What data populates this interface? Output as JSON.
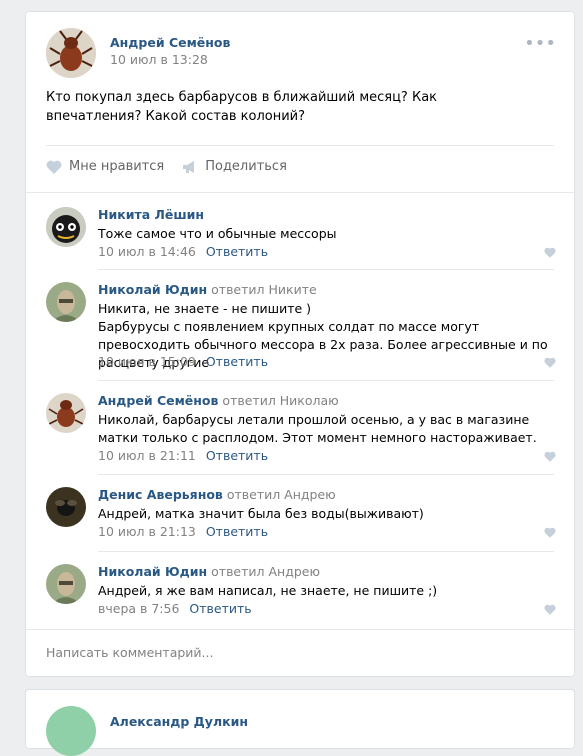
{
  "post": {
    "author": "Андрей Семёнов",
    "date": "10 июл в 13:28",
    "text": "Кто покупал здесь барбарусов в ближайший месяц? Как впечатления? Какой состав колоний?",
    "like_label": "Мне нравится",
    "share_label": "Поделиться",
    "more_icon": "more-dots-icon"
  },
  "comments": [
    {
      "author": "Никита Лёшин",
      "replied_to": "",
      "text": "Тоже самое что и обычные мессоры",
      "date": "10 июл в 14:46",
      "reply_label": "Ответить",
      "avatar_color": "#222222"
    },
    {
      "author": "Николай Юдин",
      "replied_to": "ответил Никите",
      "text": "Никита, не знаете - не пишите )\nБарбурусы с появлением крупных солдат по массе могут превосходить обычного мессора в 2х раза. Более агрессивные и по расцвету другие",
      "date": "10 июл в 15:09",
      "reply_label": "Ответить",
      "avatar_color": "#8fa07a"
    },
    {
      "author": "Андрей Семёнов",
      "replied_to": "ответил Николаю",
      "text": "Николай, барбарусы летали прошлой осенью, а у вас в магазине матки только с расплодом. Этот момент немного настораживает.",
      "date": "10 июл в 21:11",
      "reply_label": "Ответить",
      "avatar_color": "#8b3a1e"
    },
    {
      "author": "Денис Аверьянов",
      "replied_to": "ответил Андрею",
      "text": "Андрей, матка значит была без воды(выживают)",
      "date": "10 июл в 21:13",
      "reply_label": "Ответить",
      "avatar_color": "#3b3320"
    },
    {
      "author": "Николай Юдин",
      "replied_to": "ответил Андрею",
      "text": "Андрей, я же вам написал, не знаете, не пишите ;)",
      "date": "вчера в 7:56",
      "reply_label": "Ответить",
      "avatar_color": "#8fa07a"
    }
  ],
  "write_comment_placeholder": "Написать комментарий...",
  "next_post": {
    "author": "Александр Дулкин"
  },
  "colors": {
    "link": "#2a5885",
    "gray": "#828282",
    "background": "#edeef0",
    "heart": "#c5d0db"
  }
}
